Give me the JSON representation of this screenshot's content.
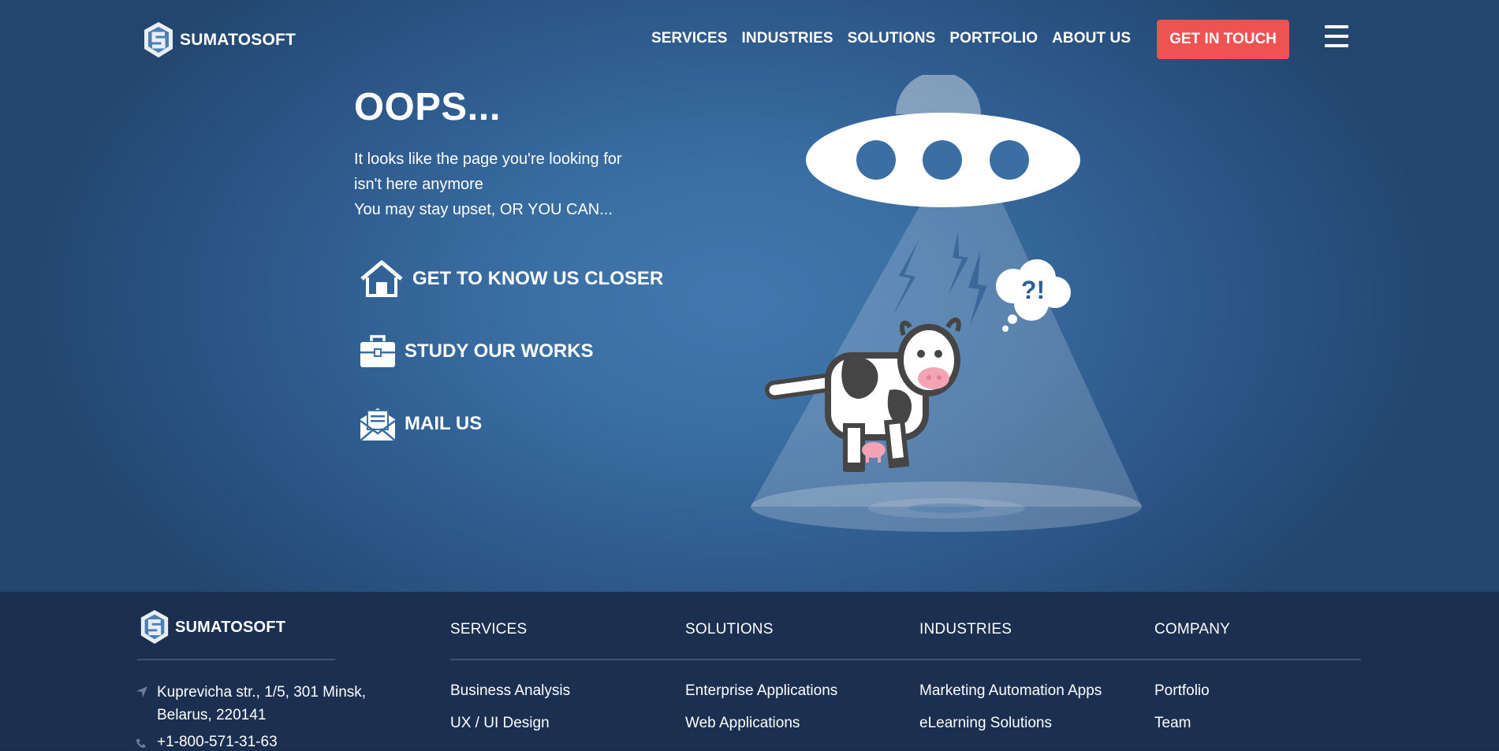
{
  "header": {
    "logo_text": "SUMATOSOFT",
    "nav": [
      "SERVICES",
      "INDUSTRIES",
      "SOLUTIONS",
      "PORTFOLIO",
      "ABOUT US"
    ],
    "cta_label": "GET IN TOUCH"
  },
  "main": {
    "title": "OOPS...",
    "description": [
      "It looks like the page you're looking for",
      "isn't here anymore",
      "You may stay upset, OR YOU CAN..."
    ],
    "actions": [
      {
        "label": "GET TO KNOW US CLOSER",
        "icon": "home-icon"
      },
      {
        "label": "STUDY OUR WORKS",
        "icon": "briefcase-icon"
      },
      {
        "label": "MAIL US",
        "icon": "mail-icon"
      }
    ],
    "illustration": {
      "thought_text": "?!"
    }
  },
  "footer": {
    "logo_text": "SUMATOSOFT",
    "address": [
      "Kuprevicha str., 1/5, 301 Minsk,",
      "Belarus, 220141"
    ],
    "phone": "+1-800-571-31-63",
    "columns": [
      {
        "heading": "SERVICES",
        "links": [
          "Business Analysis",
          "UX / UI Design"
        ]
      },
      {
        "heading": "SOLUTIONS",
        "links": [
          "Enterprise Applications",
          "Web Applications"
        ]
      },
      {
        "heading": "INDUSTRIES",
        "links": [
          "Marketing Automation Apps",
          "eLearning Solutions"
        ]
      },
      {
        "heading": "COMPANY",
        "links": [
          "Portfolio",
          "Team"
        ]
      }
    ]
  },
  "colors": {
    "accent": "#ef5351",
    "hero_bg": "#3a6fa3",
    "footer_bg": "#1b3050"
  }
}
